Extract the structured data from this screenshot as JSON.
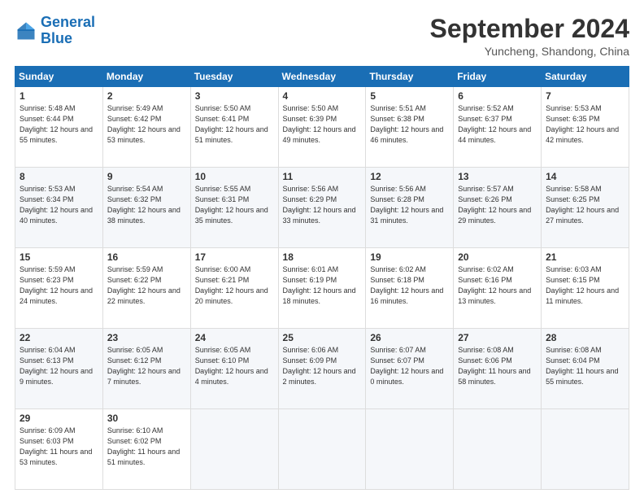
{
  "header": {
    "logo_line1": "General",
    "logo_line2": "Blue",
    "month_title": "September 2024",
    "location": "Yuncheng, Shandong, China"
  },
  "days_of_week": [
    "Sunday",
    "Monday",
    "Tuesday",
    "Wednesday",
    "Thursday",
    "Friday",
    "Saturday"
  ],
  "weeks": [
    [
      {
        "day": "1",
        "sunrise": "5:48 AM",
        "sunset": "6:44 PM",
        "daylight": "12 hours and 55 minutes."
      },
      {
        "day": "2",
        "sunrise": "5:49 AM",
        "sunset": "6:42 PM",
        "daylight": "12 hours and 53 minutes."
      },
      {
        "day": "3",
        "sunrise": "5:50 AM",
        "sunset": "6:41 PM",
        "daylight": "12 hours and 51 minutes."
      },
      {
        "day": "4",
        "sunrise": "5:50 AM",
        "sunset": "6:39 PM",
        "daylight": "12 hours and 49 minutes."
      },
      {
        "day": "5",
        "sunrise": "5:51 AM",
        "sunset": "6:38 PM",
        "daylight": "12 hours and 46 minutes."
      },
      {
        "day": "6",
        "sunrise": "5:52 AM",
        "sunset": "6:37 PM",
        "daylight": "12 hours and 44 minutes."
      },
      {
        "day": "7",
        "sunrise": "5:53 AM",
        "sunset": "6:35 PM",
        "daylight": "12 hours and 42 minutes."
      }
    ],
    [
      {
        "day": "8",
        "sunrise": "5:53 AM",
        "sunset": "6:34 PM",
        "daylight": "12 hours and 40 minutes."
      },
      {
        "day": "9",
        "sunrise": "5:54 AM",
        "sunset": "6:32 PM",
        "daylight": "12 hours and 38 minutes."
      },
      {
        "day": "10",
        "sunrise": "5:55 AM",
        "sunset": "6:31 PM",
        "daylight": "12 hours and 35 minutes."
      },
      {
        "day": "11",
        "sunrise": "5:56 AM",
        "sunset": "6:29 PM",
        "daylight": "12 hours and 33 minutes."
      },
      {
        "day": "12",
        "sunrise": "5:56 AM",
        "sunset": "6:28 PM",
        "daylight": "12 hours and 31 minutes."
      },
      {
        "day": "13",
        "sunrise": "5:57 AM",
        "sunset": "6:26 PM",
        "daylight": "12 hours and 29 minutes."
      },
      {
        "day": "14",
        "sunrise": "5:58 AM",
        "sunset": "6:25 PM",
        "daylight": "12 hours and 27 minutes."
      }
    ],
    [
      {
        "day": "15",
        "sunrise": "5:59 AM",
        "sunset": "6:23 PM",
        "daylight": "12 hours and 24 minutes."
      },
      {
        "day": "16",
        "sunrise": "5:59 AM",
        "sunset": "6:22 PM",
        "daylight": "12 hours and 22 minutes."
      },
      {
        "day": "17",
        "sunrise": "6:00 AM",
        "sunset": "6:21 PM",
        "daylight": "12 hours and 20 minutes."
      },
      {
        "day": "18",
        "sunrise": "6:01 AM",
        "sunset": "6:19 PM",
        "daylight": "12 hours and 18 minutes."
      },
      {
        "day": "19",
        "sunrise": "6:02 AM",
        "sunset": "6:18 PM",
        "daylight": "12 hours and 16 minutes."
      },
      {
        "day": "20",
        "sunrise": "6:02 AM",
        "sunset": "6:16 PM",
        "daylight": "12 hours and 13 minutes."
      },
      {
        "day": "21",
        "sunrise": "6:03 AM",
        "sunset": "6:15 PM",
        "daylight": "12 hours and 11 minutes."
      }
    ],
    [
      {
        "day": "22",
        "sunrise": "6:04 AM",
        "sunset": "6:13 PM",
        "daylight": "12 hours and 9 minutes."
      },
      {
        "day": "23",
        "sunrise": "6:05 AM",
        "sunset": "6:12 PM",
        "daylight": "12 hours and 7 minutes."
      },
      {
        "day": "24",
        "sunrise": "6:05 AM",
        "sunset": "6:10 PM",
        "daylight": "12 hours and 4 minutes."
      },
      {
        "day": "25",
        "sunrise": "6:06 AM",
        "sunset": "6:09 PM",
        "daylight": "12 hours and 2 minutes."
      },
      {
        "day": "26",
        "sunrise": "6:07 AM",
        "sunset": "6:07 PM",
        "daylight": "12 hours and 0 minutes."
      },
      {
        "day": "27",
        "sunrise": "6:08 AM",
        "sunset": "6:06 PM",
        "daylight": "11 hours and 58 minutes."
      },
      {
        "day": "28",
        "sunrise": "6:08 AM",
        "sunset": "6:04 PM",
        "daylight": "11 hours and 55 minutes."
      }
    ],
    [
      {
        "day": "29",
        "sunrise": "6:09 AM",
        "sunset": "6:03 PM",
        "daylight": "11 hours and 53 minutes."
      },
      {
        "day": "30",
        "sunrise": "6:10 AM",
        "sunset": "6:02 PM",
        "daylight": "11 hours and 51 minutes."
      },
      null,
      null,
      null,
      null,
      null
    ]
  ]
}
